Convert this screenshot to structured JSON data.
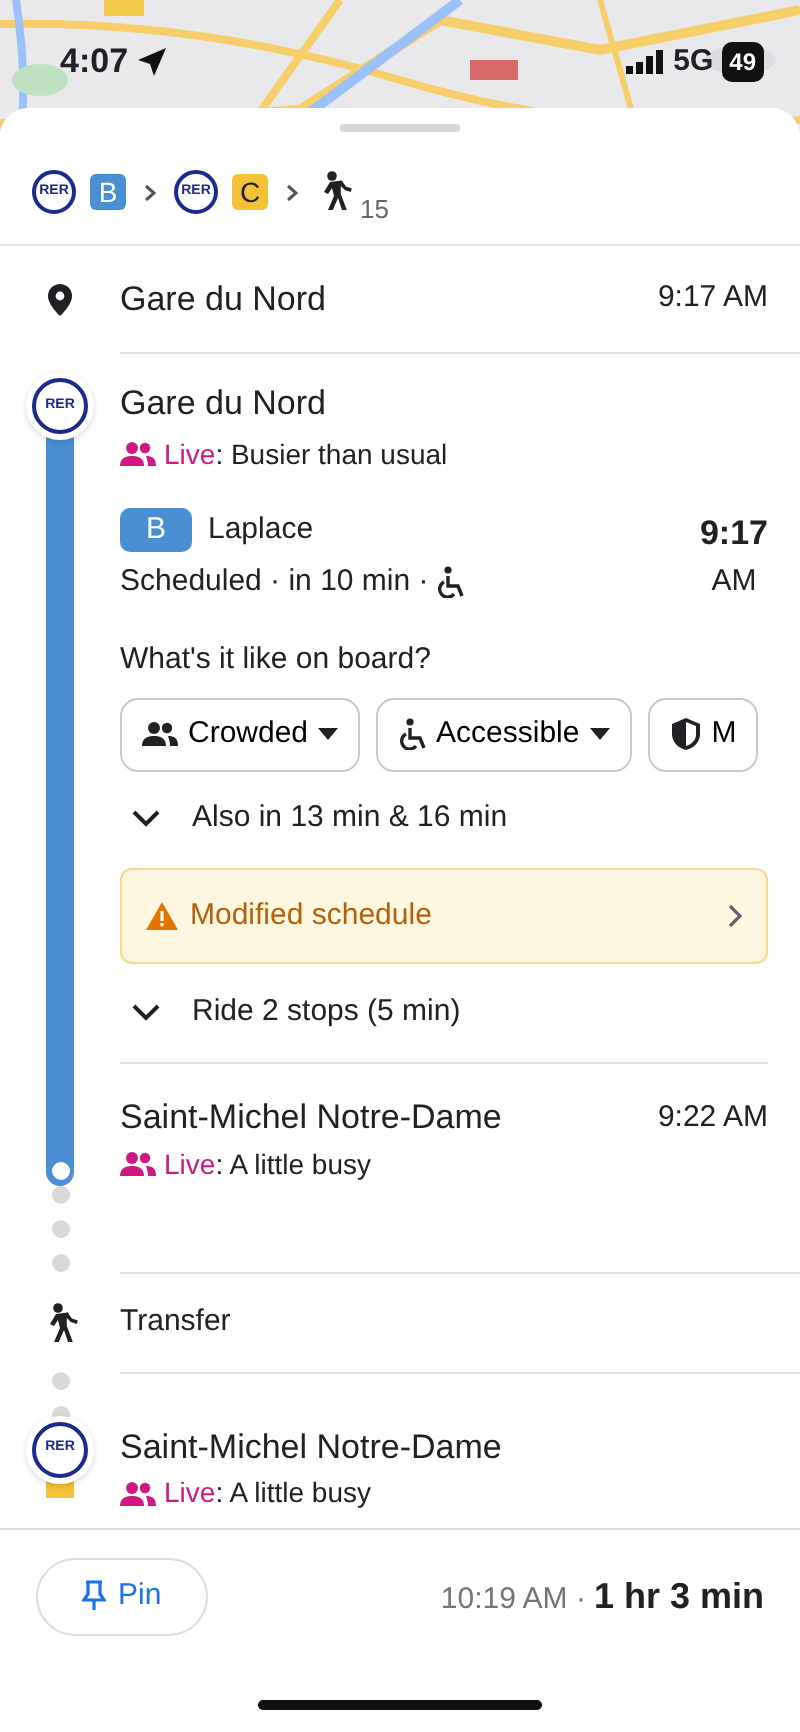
{
  "status_bar": {
    "time": "4:07",
    "network": "5G",
    "battery": "49"
  },
  "route_summary": [
    {
      "kind": "line",
      "network": "RER",
      "line": "B",
      "color": "#4a8fd1"
    },
    {
      "kind": "line",
      "network": "RER",
      "line": "C",
      "color": "#f3c237"
    },
    {
      "kind": "walk",
      "minutes": "15"
    }
  ],
  "start": {
    "name": "Gare du Nord",
    "time": "9:17 AM"
  },
  "board_stop": {
    "network": "RER",
    "name": "Gare du Nord",
    "live_label": "Live",
    "live_status": ": Busier than usual"
  },
  "departure": {
    "line": "B",
    "color": "#4a8fd1",
    "headsign": "Laplace",
    "status": "Scheduled · in 10 min ·",
    "accessible": true,
    "time": "9:17",
    "period": "AM"
  },
  "on_board": {
    "question": "What's it like on board?",
    "chips": [
      {
        "kind": "crowd",
        "label": "Crowded",
        "dropdown": true
      },
      {
        "kind": "accessible",
        "label": "Accessible",
        "dropdown": true
      },
      {
        "kind": "safety",
        "label": "M",
        "dropdown": false
      }
    ]
  },
  "more_departures": "Also in 13 min & 16 min",
  "alert": "Modified schedule",
  "ride": "Ride 2 stops (5 min)",
  "alight_stop": {
    "name": "Saint-Michel Notre-Dame",
    "time": "9:22 AM",
    "live_label": "Live",
    "live_status": ": A little busy"
  },
  "transfer": "Transfer",
  "next_stop": {
    "network": "RER",
    "color": "#f3c237",
    "name": "Saint-Michel Notre-Dame",
    "live_label": "Live",
    "live_status": ": A little busy"
  },
  "footer": {
    "pin": "Pin",
    "arrival": "10:19 AM ·",
    "duration": "1 hr 3 min"
  }
}
